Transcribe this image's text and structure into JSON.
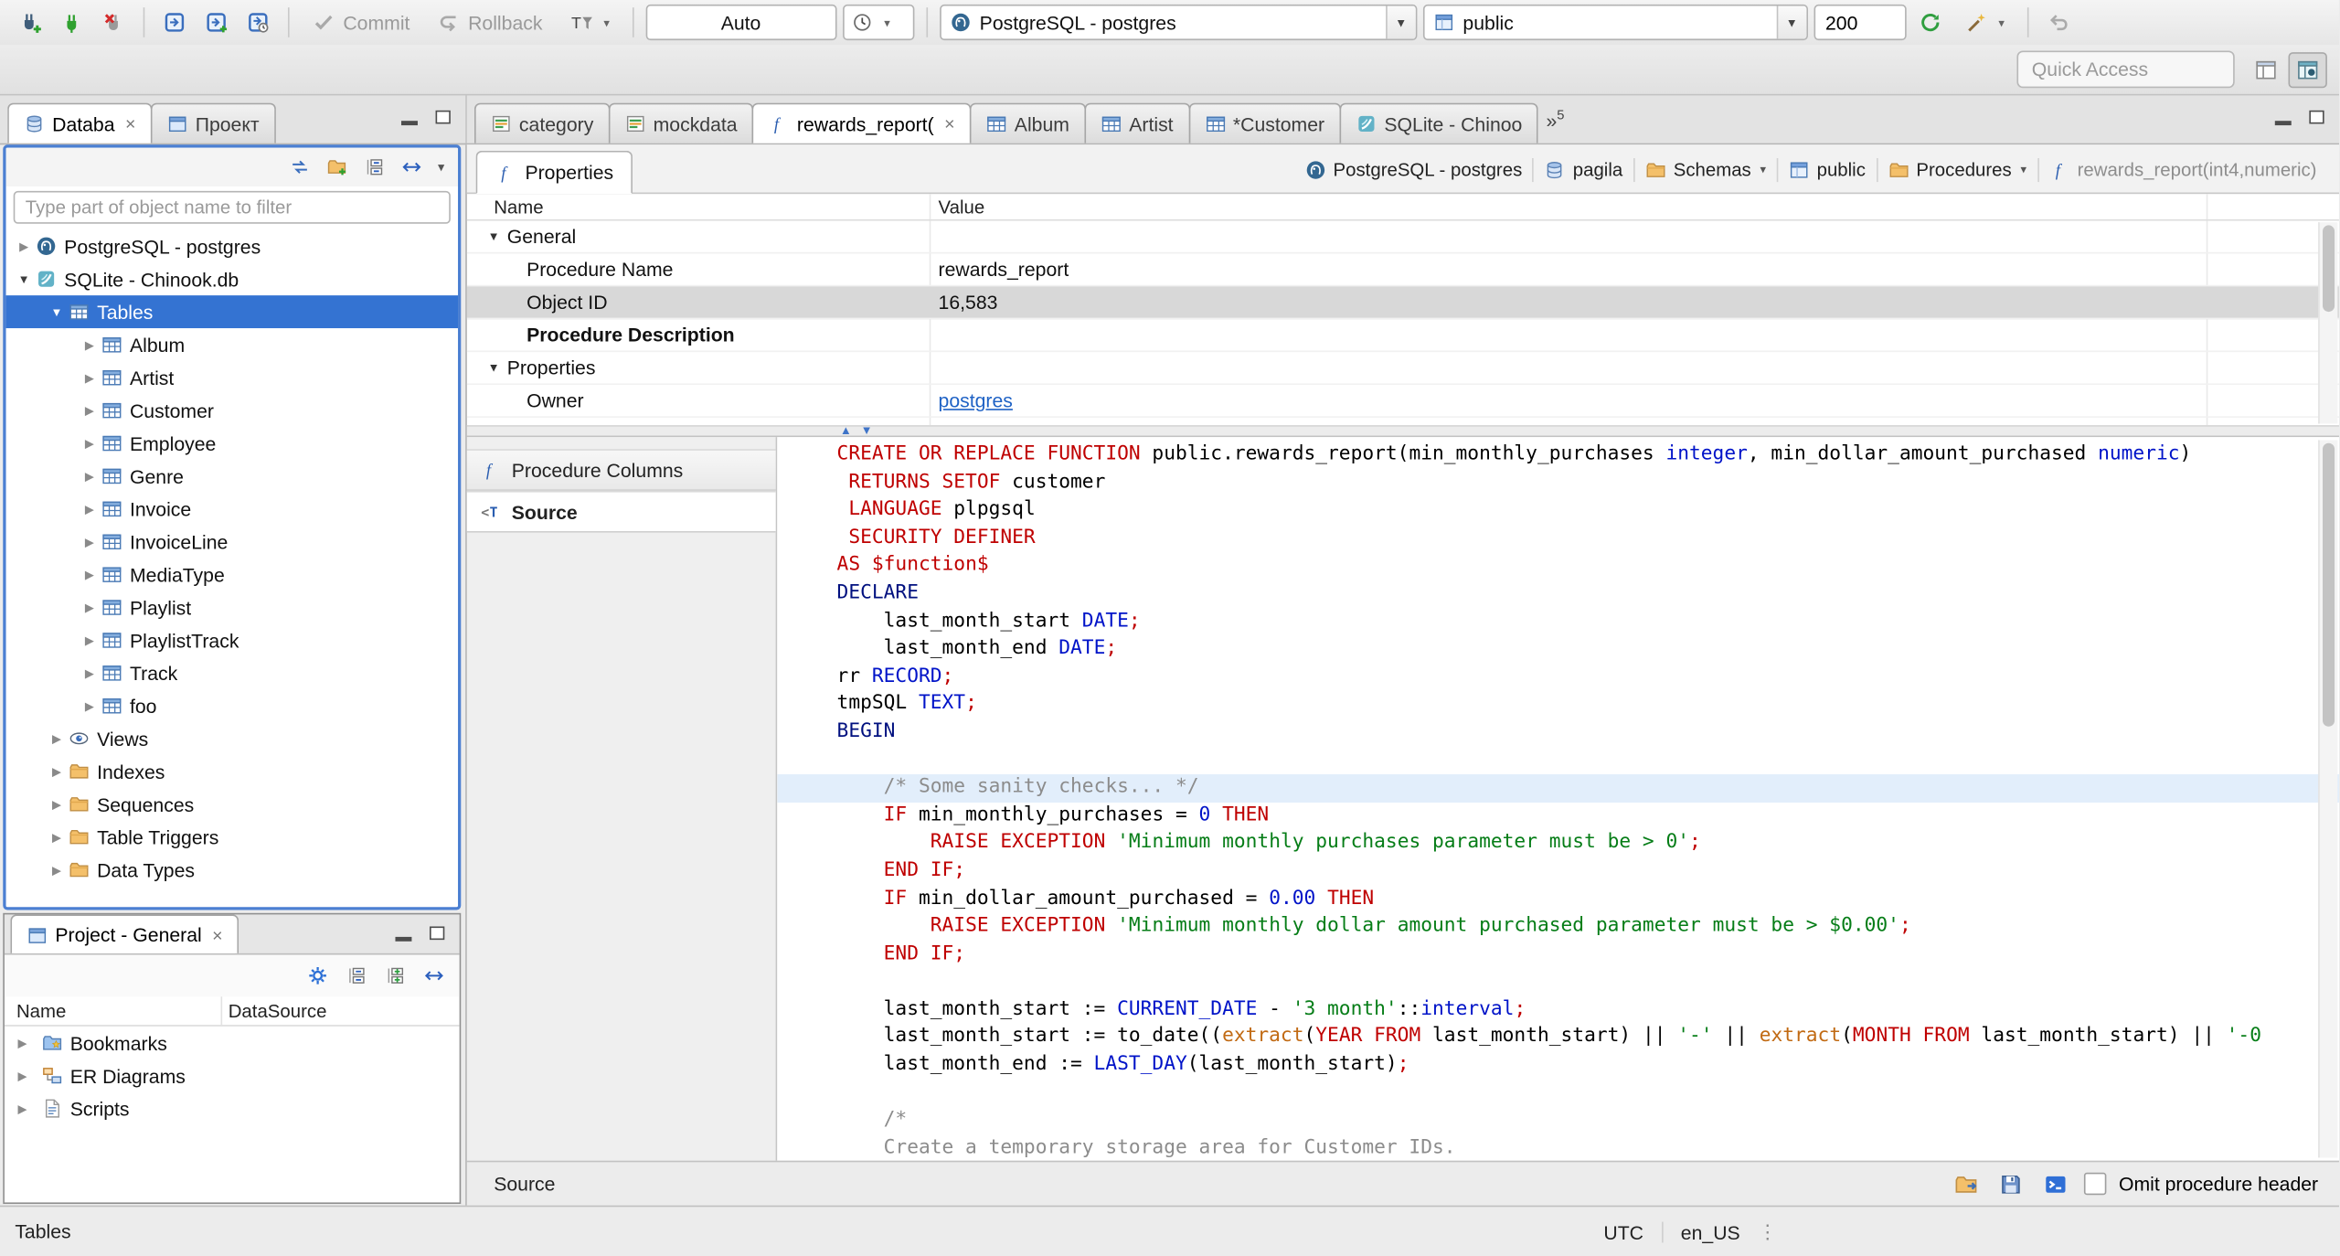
{
  "toolbar": {
    "commit_label": "Commit",
    "rollback_label": "Rollback",
    "auto_value": "Auto",
    "connection_value": "PostgreSQL - postgres",
    "schema_value": "public",
    "fetch_size_value": "200"
  },
  "quick_access": {
    "placeholder": "Quick Access"
  },
  "sidebar": {
    "tabs": [
      {
        "label": "Databa",
        "icon": "database",
        "active": true,
        "closable": true
      },
      {
        "label": "Проект",
        "icon": "project",
        "active": false
      }
    ],
    "filter_placeholder": "Type part of object name to filter",
    "tree": [
      {
        "label": "PostgreSQL - postgres",
        "level": 0,
        "state": "collapsed",
        "icon": "postgres"
      },
      {
        "label": "SQLite - Chinook.db",
        "level": 0,
        "state": "expanded",
        "icon": "sqlite"
      },
      {
        "label": "Tables",
        "level": 1,
        "state": "expanded",
        "icon": "table",
        "selected": true
      },
      {
        "label": "Album",
        "level": 2,
        "state": "collapsed",
        "icon": "table"
      },
      {
        "label": "Artist",
        "level": 2,
        "state": "collapsed",
        "icon": "table"
      },
      {
        "label": "Customer",
        "level": 2,
        "state": "collapsed",
        "icon": "table"
      },
      {
        "label": "Employee",
        "level": 2,
        "state": "collapsed",
        "icon": "table"
      },
      {
        "label": "Genre",
        "level": 2,
        "state": "collapsed",
        "icon": "table"
      },
      {
        "label": "Invoice",
        "level": 2,
        "state": "collapsed",
        "icon": "table"
      },
      {
        "label": "InvoiceLine",
        "level": 2,
        "state": "collapsed",
        "icon": "table"
      },
      {
        "label": "MediaType",
        "level": 2,
        "state": "collapsed",
        "icon": "table"
      },
      {
        "label": "Playlist",
        "level": 2,
        "state": "collapsed",
        "icon": "table"
      },
      {
        "label": "PlaylistTrack",
        "level": 2,
        "state": "collapsed",
        "icon": "table"
      },
      {
        "label": "Track",
        "level": 2,
        "state": "collapsed",
        "icon": "table"
      },
      {
        "label": "foo",
        "level": 2,
        "state": "collapsed",
        "icon": "table"
      },
      {
        "label": "Views",
        "level": 1,
        "state": "collapsed",
        "icon": "views"
      },
      {
        "label": "Indexes",
        "level": 1,
        "state": "collapsed",
        "icon": "folder"
      },
      {
        "label": "Sequences",
        "level": 1,
        "state": "collapsed",
        "icon": "folder"
      },
      {
        "label": "Table Triggers",
        "level": 1,
        "state": "collapsed",
        "icon": "folder"
      },
      {
        "label": "Data Types",
        "level": 1,
        "state": "collapsed",
        "icon": "folder"
      }
    ]
  },
  "project_panel": {
    "tab_label": "Project - General",
    "columns": [
      "Name",
      "DataSource"
    ],
    "rows": [
      {
        "label": "Bookmarks",
        "icon": "bookmarks"
      },
      {
        "label": "ER Diagrams",
        "icon": "er-diagram"
      },
      {
        "label": "Scripts",
        "icon": "scripts"
      }
    ]
  },
  "editor_tabs": [
    {
      "label": "category",
      "icon": "data-table"
    },
    {
      "label": "mockdata",
      "icon": "data-table"
    },
    {
      "label": "rewards_report(",
      "icon": "function",
      "active": true,
      "closable": true
    },
    {
      "label": "Album",
      "icon": "table"
    },
    {
      "label": "Artist",
      "icon": "table"
    },
    {
      "label": "*Customer",
      "icon": "table"
    },
    {
      "label": "SQLite - Chinoo",
      "icon": "sqlite"
    }
  ],
  "editor_tabs_overflow": "5",
  "properties_view": {
    "tab_label": "Properties",
    "breadcrumb": [
      {
        "label": "PostgreSQL - postgres",
        "icon": "postgres"
      },
      {
        "label": "pagila",
        "icon": "database"
      },
      {
        "label": "Schemas",
        "icon": "folder",
        "dropdown": true
      },
      {
        "label": "public",
        "icon": "schema"
      },
      {
        "label": "Procedures",
        "icon": "folder",
        "dropdown": true
      },
      {
        "label": "rewards_report(int4,numeric)",
        "icon": "function",
        "muted": true
      }
    ],
    "columns": [
      "Name",
      "Value"
    ],
    "rows": [
      {
        "name": "General",
        "group": true
      },
      {
        "name": "Procedure Name",
        "value": "rewards_report",
        "indent": true
      },
      {
        "name": "Object ID",
        "value": "16,583",
        "indent": true,
        "selected": true
      },
      {
        "name": "Procedure Description",
        "indent": true,
        "bold": true
      },
      {
        "name": "Properties",
        "group": true
      },
      {
        "name": "Owner",
        "value": "postgres",
        "indent": true,
        "link": true
      }
    ],
    "side_items": [
      {
        "label": "Procedure Columns",
        "icon": "function"
      },
      {
        "label": "Source",
        "icon": "source",
        "selected": true
      }
    ]
  },
  "source_editor": {
    "lines": [
      {
        "t": [
          [
            "kw",
            "CREATE OR REPLACE FUNCTION"
          ],
          [
            "pl",
            " public.rewards_report(min_monthly_purchases "
          ],
          [
            "ty",
            "integer"
          ],
          [
            "pl",
            ", min_dollar_amount_purchased "
          ],
          [
            "ty",
            "numeric"
          ],
          [
            "pl",
            ")"
          ]
        ]
      },
      {
        "t": [
          [
            "pl",
            " "
          ],
          [
            "kw",
            "RETURNS SETOF"
          ],
          [
            "pl",
            " customer"
          ]
        ]
      },
      {
        "t": [
          [
            "pl",
            " "
          ],
          [
            "kw",
            "LANGUAGE"
          ],
          [
            "pl",
            " plpgsql"
          ]
        ]
      },
      {
        "t": [
          [
            "pl",
            " "
          ],
          [
            "kw",
            "SECURITY DEFINER"
          ]
        ]
      },
      {
        "t": [
          [
            "kw",
            "AS"
          ],
          [
            "pl",
            " "
          ],
          [
            "kw",
            "$function$"
          ]
        ]
      },
      {
        "t": [
          [
            "bk",
            "DECLARE"
          ]
        ]
      },
      {
        "t": [
          [
            "pl",
            "    last_month_start "
          ],
          [
            "ty",
            "DATE"
          ],
          [
            "kw",
            ";"
          ]
        ]
      },
      {
        "t": [
          [
            "pl",
            "    last_month_end "
          ],
          [
            "ty",
            "DATE"
          ],
          [
            "kw",
            ";"
          ]
        ]
      },
      {
        "t": [
          [
            "pl",
            "rr "
          ],
          [
            "ty",
            "RECORD"
          ],
          [
            "kw",
            ";"
          ]
        ]
      },
      {
        "t": [
          [
            "pl",
            "tmpSQL "
          ],
          [
            "ty",
            "TEXT"
          ],
          [
            "kw",
            ";"
          ]
        ]
      },
      {
        "t": [
          [
            "bk",
            "BEGIN"
          ]
        ]
      },
      {
        "t": []
      },
      {
        "h": true,
        "t": [
          [
            "pl",
            "    "
          ],
          [
            "cm",
            "/* Some sanity checks... */"
          ]
        ]
      },
      {
        "t": [
          [
            "pl",
            "    "
          ],
          [
            "kw",
            "IF"
          ],
          [
            "pl",
            " min_monthly_purchases = "
          ],
          [
            "nm",
            "0"
          ],
          [
            "pl",
            " "
          ],
          [
            "kw",
            "THEN"
          ]
        ]
      },
      {
        "t": [
          [
            "pl",
            "        "
          ],
          [
            "kw",
            "RAISE EXCEPTION"
          ],
          [
            "pl",
            " "
          ],
          [
            "st",
            "'Minimum monthly purchases parameter must be > 0'"
          ],
          [
            "kw",
            ";"
          ]
        ]
      },
      {
        "t": [
          [
            "pl",
            "    "
          ],
          [
            "kw",
            "END IF;"
          ]
        ]
      },
      {
        "t": [
          [
            "pl",
            "    "
          ],
          [
            "kw",
            "IF"
          ],
          [
            "pl",
            " min_dollar_amount_purchased = "
          ],
          [
            "nm",
            "0.00"
          ],
          [
            "pl",
            " "
          ],
          [
            "kw",
            "THEN"
          ]
        ]
      },
      {
        "t": [
          [
            "pl",
            "        "
          ],
          [
            "kw",
            "RAISE EXCEPTION"
          ],
          [
            "pl",
            " "
          ],
          [
            "st",
            "'Minimum monthly dollar amount purchased parameter must be > $0.00'"
          ],
          [
            "kw",
            ";"
          ]
        ]
      },
      {
        "t": [
          [
            "pl",
            "    "
          ],
          [
            "kw",
            "END IF;"
          ]
        ]
      },
      {
        "t": []
      },
      {
        "t": [
          [
            "pl",
            "    last_month_start := "
          ],
          [
            "ty",
            "CURRENT_DATE"
          ],
          [
            "pl",
            " - "
          ],
          [
            "st",
            "'3 month'"
          ],
          [
            "pl",
            "::"
          ],
          [
            "ty",
            "interval"
          ],
          [
            "kw",
            ";"
          ]
        ]
      },
      {
        "t": [
          [
            "pl",
            "    last_month_start := to_date(("
          ],
          [
            "fn",
            "extract"
          ],
          [
            "pl",
            "("
          ],
          [
            "kw",
            "YEAR FROM"
          ],
          [
            "pl",
            " last_month_start) || "
          ],
          [
            "st",
            "'-'"
          ],
          [
            "pl",
            " || "
          ],
          [
            "fn",
            "extract"
          ],
          [
            "pl",
            "("
          ],
          [
            "kw",
            "MONTH FROM"
          ],
          [
            "pl",
            " last_month_start) || "
          ],
          [
            "st",
            "'-0"
          ]
        ]
      },
      {
        "t": [
          [
            "pl",
            "    last_month_end := "
          ],
          [
            "ty",
            "LAST_DAY"
          ],
          [
            "pl",
            "(last_month_start)"
          ],
          [
            "kw",
            ";"
          ]
        ]
      },
      {
        "t": []
      },
      {
        "t": [
          [
            "pl",
            "    "
          ],
          [
            "cm",
            "/*"
          ]
        ]
      },
      {
        "t": [
          [
            "cm",
            "    Create a temporary storage area for Customer IDs."
          ]
        ]
      },
      {
        "t": [
          [
            "cm",
            "    */"
          ]
        ]
      }
    ]
  },
  "editor_footer": {
    "status": "Source",
    "omit_checkbox_label": "Omit procedure header"
  },
  "statusbar": {
    "left": "Tables",
    "timezone": "UTC",
    "locale": "en_US"
  }
}
